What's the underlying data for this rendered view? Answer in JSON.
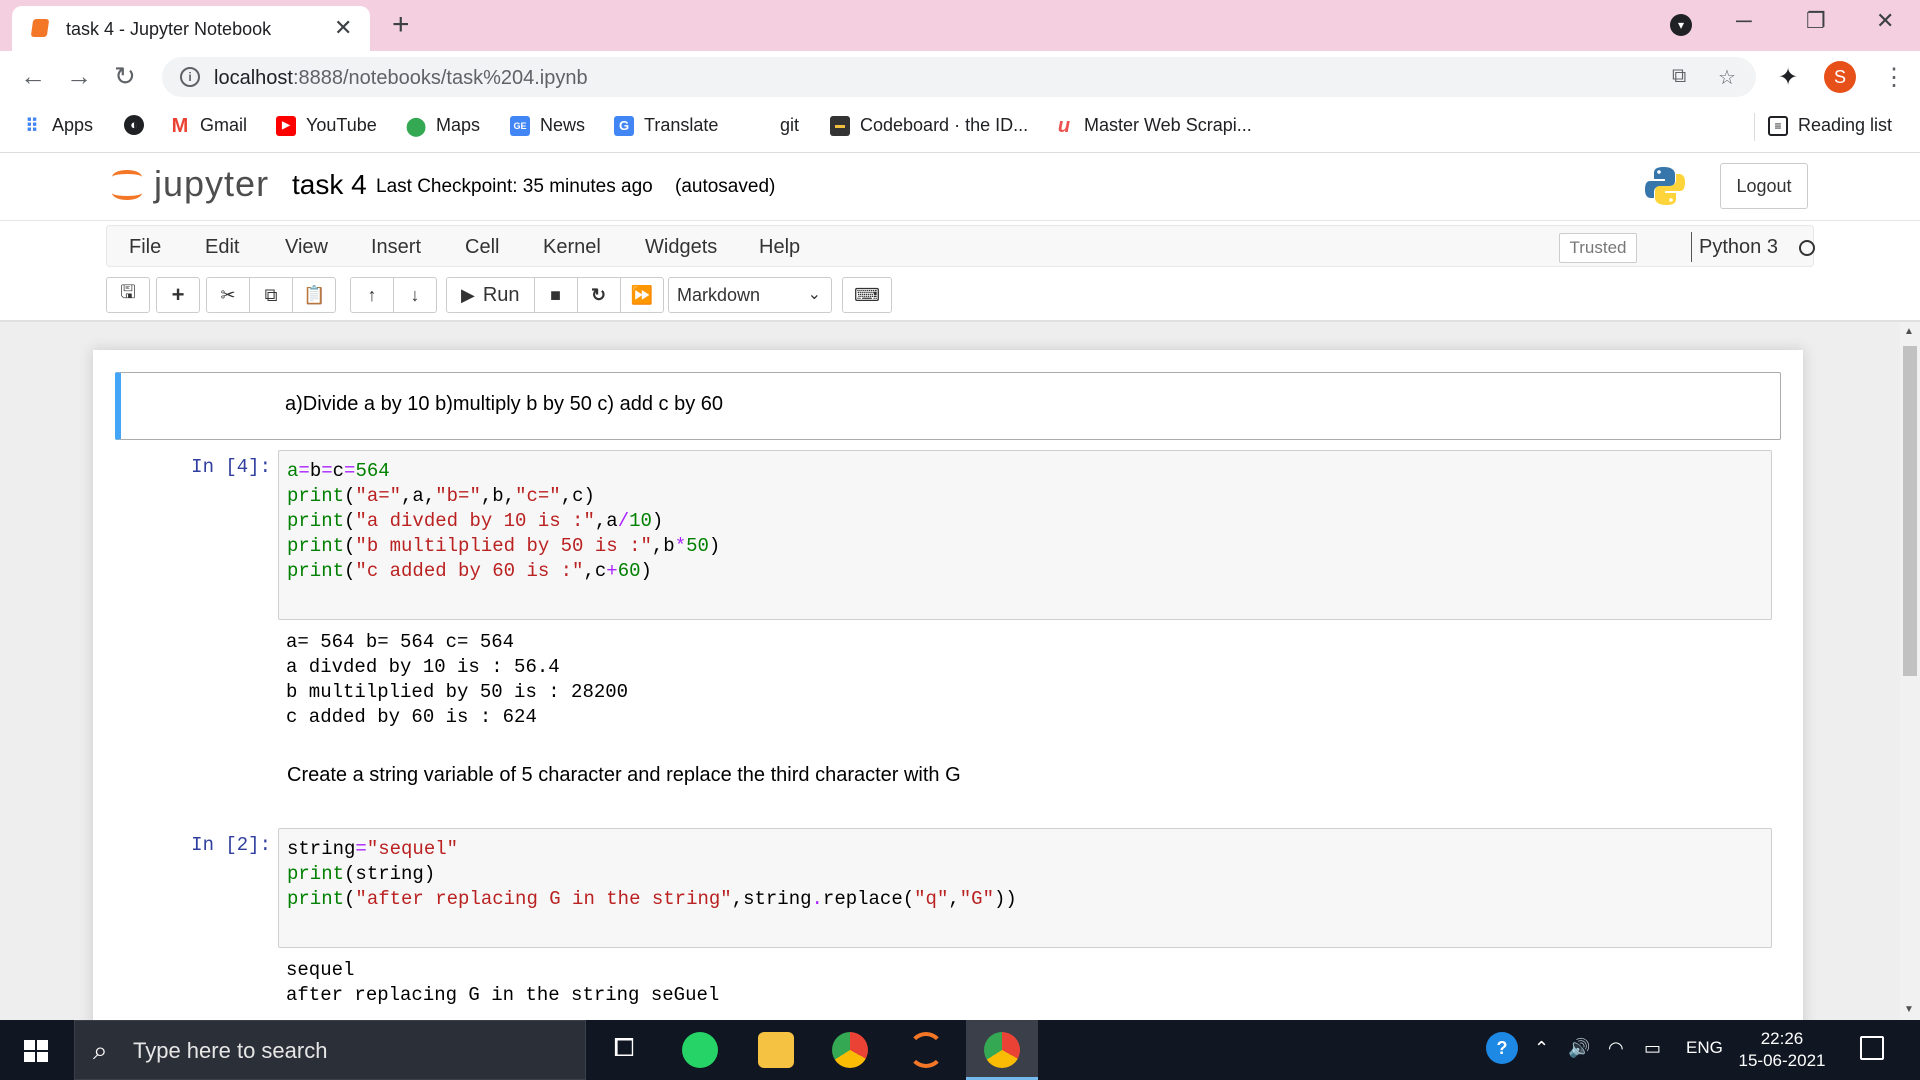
{
  "browser": {
    "tab_title": "task 4 - Jupyter Notebook",
    "tab_close": "✕",
    "new_tab": "+",
    "url_host": "localhost",
    "url_path": ":8888/notebooks/task%204.ipynb",
    "profile_initial": "S",
    "bookmarks": [
      {
        "label": "Apps",
        "icon": "apps-grid-icon"
      },
      {
        "label": "Gmail",
        "icon": "gmail-icon"
      },
      {
        "label": "YouTube",
        "icon": "youtube-icon"
      },
      {
        "label": "Maps",
        "icon": "maps-icon"
      },
      {
        "label": "News",
        "icon": "news-icon"
      },
      {
        "label": "Translate",
        "icon": "translate-icon"
      },
      {
        "label": "git",
        "icon": ""
      },
      {
        "label": "Codeboard · the ID...",
        "icon": "codeboard-icon"
      },
      {
        "label": "Master Web Scrapi...",
        "icon": "udemy-icon"
      }
    ],
    "reading_list": "Reading list"
  },
  "jupyter": {
    "logo_text": "jupyter",
    "notebook_name": "task 4",
    "checkpoint": "Last Checkpoint: 35 minutes ago",
    "autosaved": "(autosaved)",
    "logout": "Logout",
    "menu": [
      "File",
      "Edit",
      "View",
      "Insert",
      "Cell",
      "Kernel",
      "Widgets",
      "Help"
    ],
    "trusted": "Trusted",
    "kernel": "Python 3",
    "run_label": "Run",
    "cell_type": "Markdown"
  },
  "cells": {
    "md1": "a)Divide a by 10 b)multiply b by 50 c) add c by 60",
    "code1_prompt": "In [4]:",
    "code1_output": [
      "a= 564 b= 564 c= 564",
      "a divded by 10 is : 56.4",
      "b multilplied by 50 is : 28200",
      "c added by 60 is : 624"
    ],
    "md2": "Create a string variable of 5 character and replace the third character with G",
    "code2_prompt": "In [2]:",
    "code2_output": [
      "sequel",
      "after replacing G in the string seGuel"
    ]
  },
  "taskbar": {
    "search_placeholder": "Type here to search",
    "language": "ENG",
    "time": "22:26",
    "date": "15-06-2021"
  },
  "colors": {
    "tabstrip": "#f3cfe0",
    "jupyter_orange": "#f37726",
    "selected_cell_border": "#42a5f5",
    "prompt_blue": "#303f9f",
    "code_keyword": "#008000",
    "code_string": "#ba2121"
  }
}
